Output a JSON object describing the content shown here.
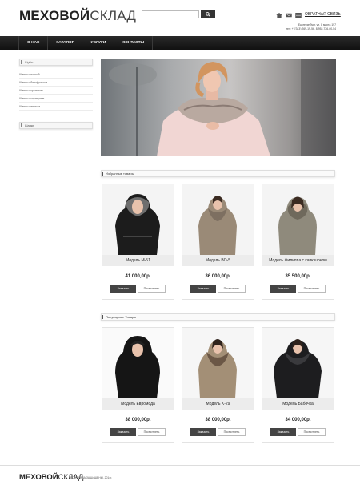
{
  "header": {
    "logo_bold": "МЕХОВОЙ",
    "logo_light": "СКЛАД",
    "search_placeholder": "",
    "feedback_link": "ОБРАТНАЯ СВЯЗЬ",
    "address_line1": "Екатеринбург, ул. 8 марта 197",
    "address_line2": "тел: +7(343) 269-19-56, 8-952-726-00-54"
  },
  "nav": {
    "items": [
      "О НАС",
      "КАТАЛОГ",
      "УСЛУГИ",
      "КОНТАКТЫ"
    ]
  },
  "sidebar": {
    "furs_title": "Шубы",
    "items": [
      "Шапки с норкой",
      "Шапки с блюфростом",
      "Шапки с кроликом",
      "Шапки с каракулем",
      "Шапки с енотом"
    ],
    "hats_title": "Шапки"
  },
  "featured": {
    "title": "Избранные товары",
    "products": [
      {
        "name": "Модель М-51",
        "price": "41 000,00р."
      },
      {
        "name": "Модель BO-5",
        "price": "36 000,00р."
      },
      {
        "name": "Модель Филиппа с капюшоном",
        "price": "35 500,00р."
      }
    ]
  },
  "popular": {
    "title": "Популярные Товары",
    "products": [
      {
        "name": "Модель Евромода",
        "price": "38 000,00р."
      },
      {
        "name": "Модель K-29",
        "price": "38 000,00р."
      },
      {
        "name": "Модель Бабочка",
        "price": "34 000,00р."
      }
    ]
  },
  "buttons": {
    "order": "Заказать",
    "view": "Посмотреть"
  },
  "footer": {
    "logo_bold": "МЕХОВОЙ",
    "logo_light": "СКЛАД",
    "copyright": "ВСЕ ПРАВА ЗАЩИЩЕНЫ, 2014г."
  },
  "icons": [
    "home-icon",
    "mail-icon",
    "sitemap-icon",
    "search-icon"
  ],
  "colors": {
    "nav_bg": "#1a1a1a",
    "order_button": "#444444",
    "name_bar": "#ececec"
  }
}
